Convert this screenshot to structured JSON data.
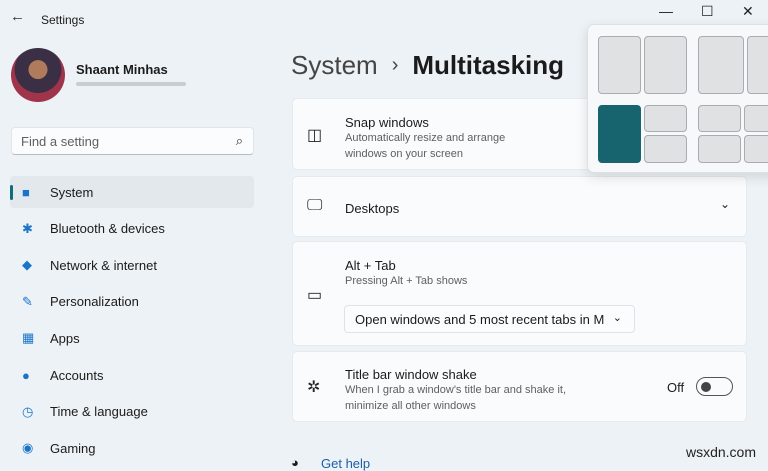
{
  "window": {
    "title": "Settings",
    "back_icon": "arrow-left-icon",
    "minimize": "minimize-icon",
    "maximize": "maximize-icon",
    "close": "close-icon"
  },
  "user": {
    "name": "Shaant Minhas"
  },
  "search": {
    "placeholder": "Find a setting"
  },
  "sidebar": {
    "items": [
      {
        "label": "System",
        "icon": "■",
        "color": "#1a74c9"
      },
      {
        "label": "Bluetooth & devices",
        "icon": "✱"
      },
      {
        "label": "Network & internet",
        "icon": "◆"
      },
      {
        "label": "Personalization",
        "icon": "✎"
      },
      {
        "label": "Apps",
        "icon": "▦"
      },
      {
        "label": "Accounts",
        "icon": "●"
      },
      {
        "label": "Time & language",
        "icon": "◷"
      },
      {
        "label": "Gaming",
        "icon": "◉"
      }
    ],
    "selected": 0
  },
  "breadcrumb": {
    "parent": "System",
    "separator": "›",
    "current": "Multitasking"
  },
  "cards": {
    "snap": {
      "title": "Snap windows",
      "desc": "Automatically resize and arrange windows on your screen"
    },
    "desktops": {
      "title": "Desktops"
    },
    "alttab": {
      "title": "Alt + Tab",
      "desc": "Pressing Alt + Tab shows",
      "value": "Open windows and 5 most recent tabs in M"
    },
    "shake": {
      "title": "Title bar window shake",
      "desc": "When I grab a window's title bar and shake it, minimize all other windows",
      "state": "Off",
      "on": false
    }
  },
  "get_help": "Get help",
  "watermark": "wsxdn.com",
  "colors": {
    "accent": "#17646f"
  }
}
